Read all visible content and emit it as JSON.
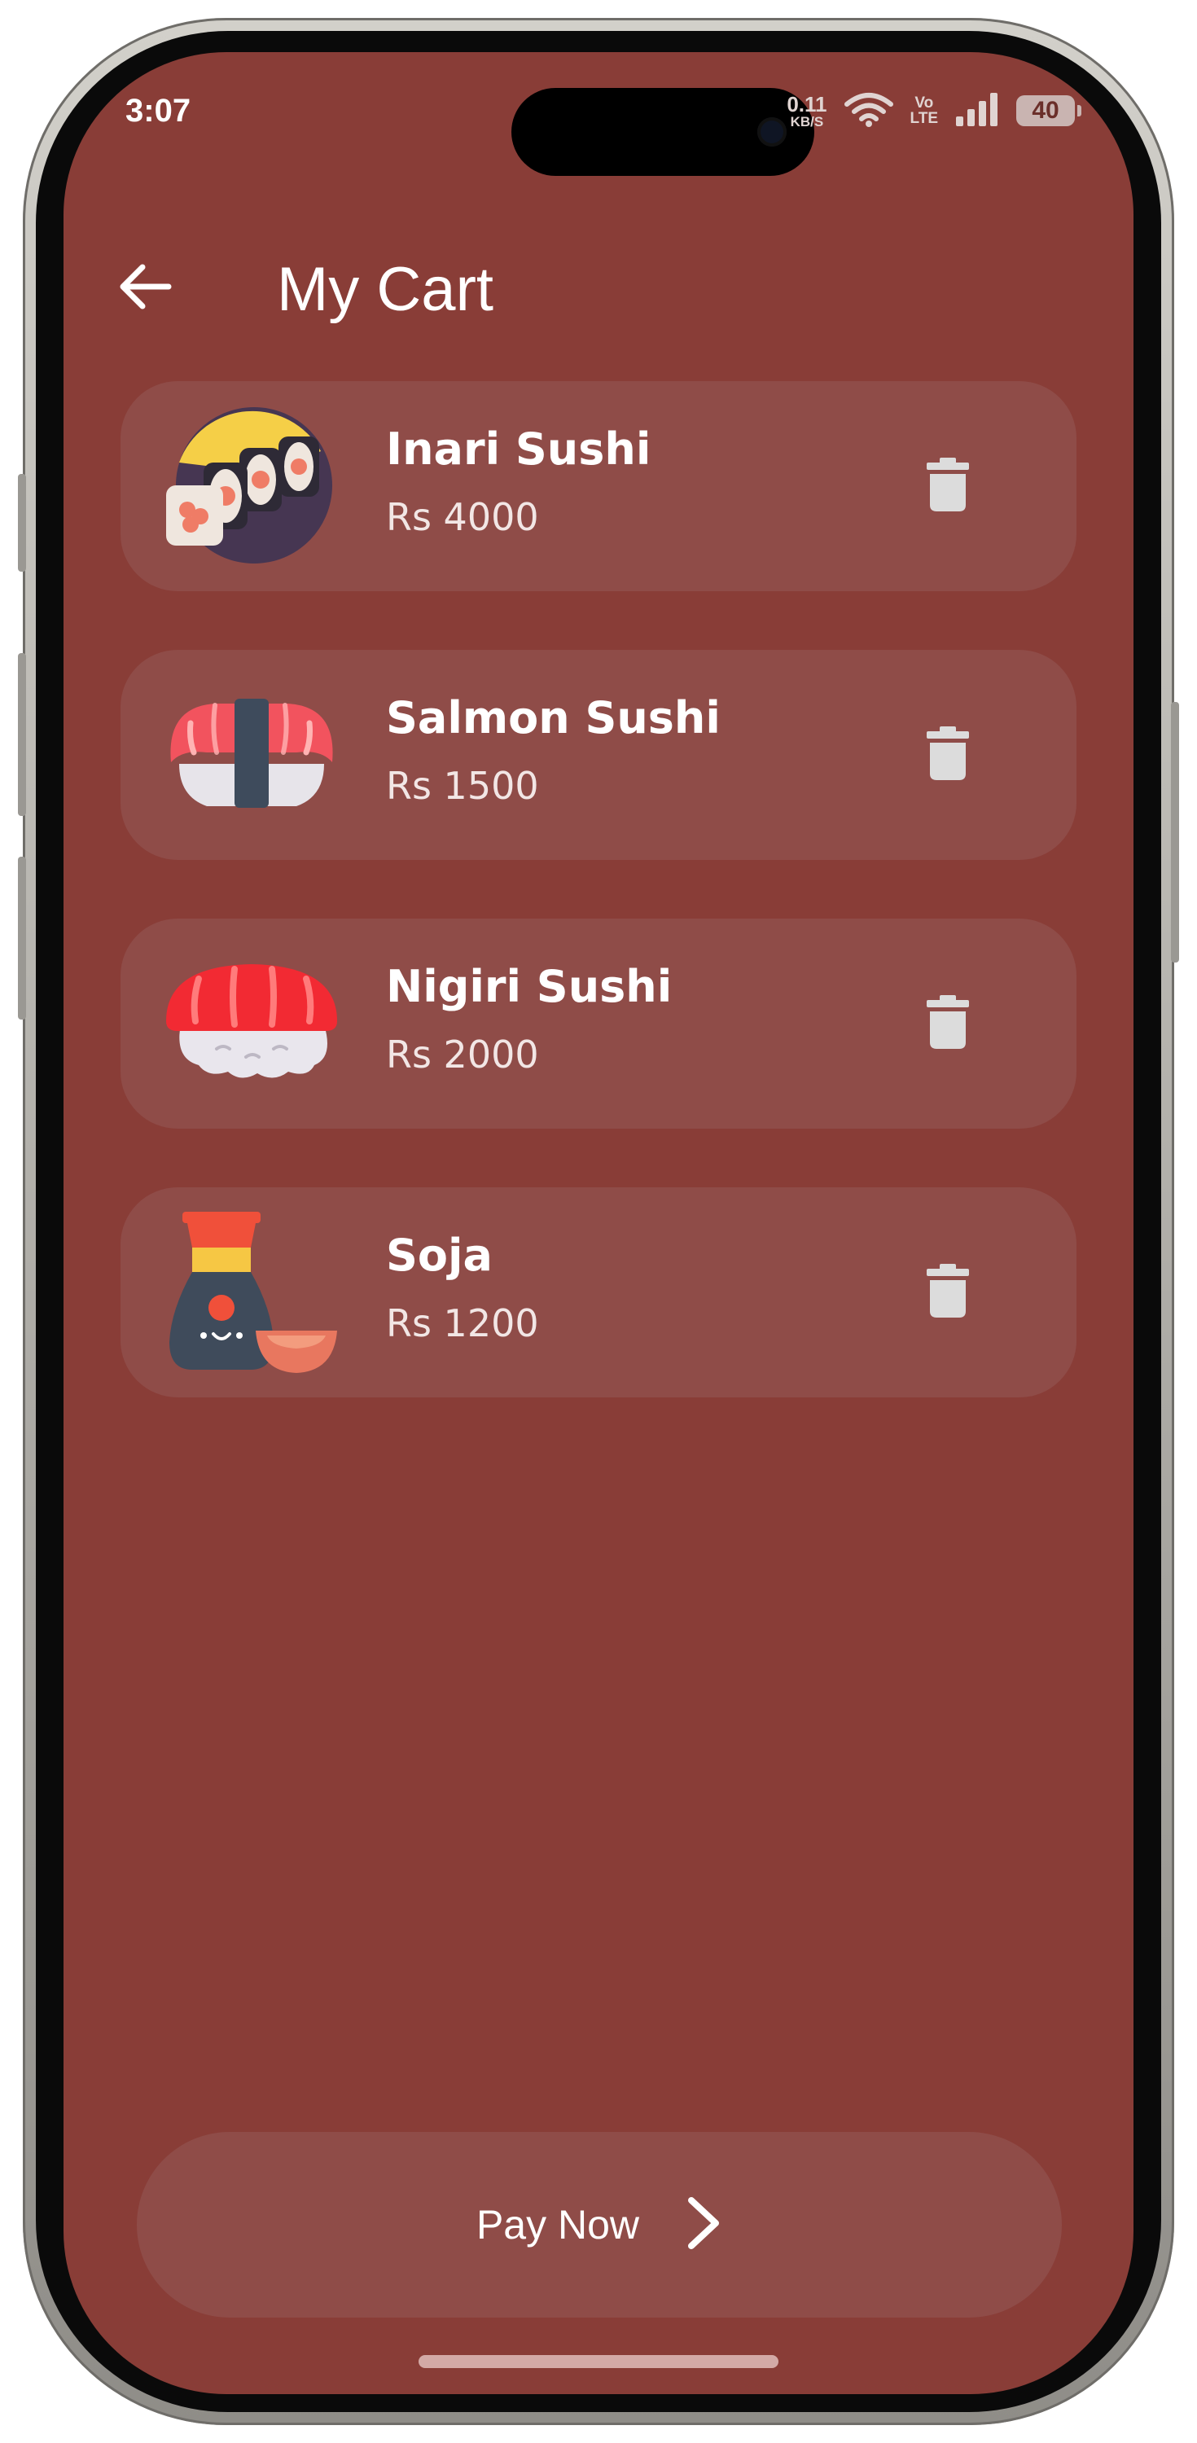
{
  "status_bar": {
    "time": "3:07",
    "net_speed_value": "0.11",
    "net_speed_unit": "KB/S",
    "volte_top": "Vo",
    "volte_bottom": "LTE",
    "battery": "40"
  },
  "header": {
    "title": "My Cart",
    "back_icon": "arrow-left-icon"
  },
  "cart": {
    "items": [
      {
        "name": "Inari Sushi",
        "price": "Rs 4000",
        "icon": "sushi-roll-icon"
      },
      {
        "name": "Salmon Sushi",
        "price": "Rs 1500",
        "icon": "salmon-sushi-icon"
      },
      {
        "name": "Nigiri Sushi",
        "price": "Rs 2000",
        "icon": "nigiri-sushi-icon"
      },
      {
        "name": "Soja",
        "price": "Rs 1200",
        "icon": "soy-sauce-icon"
      }
    ],
    "delete_icon": "trash-icon"
  },
  "pay": {
    "label": "Pay Now",
    "icon": "chevron-right-icon"
  },
  "colors": {
    "background": "#893d37",
    "card": "#8f4c48",
    "text": "#ffffff",
    "icon_gray": "#dcdcdc"
  }
}
